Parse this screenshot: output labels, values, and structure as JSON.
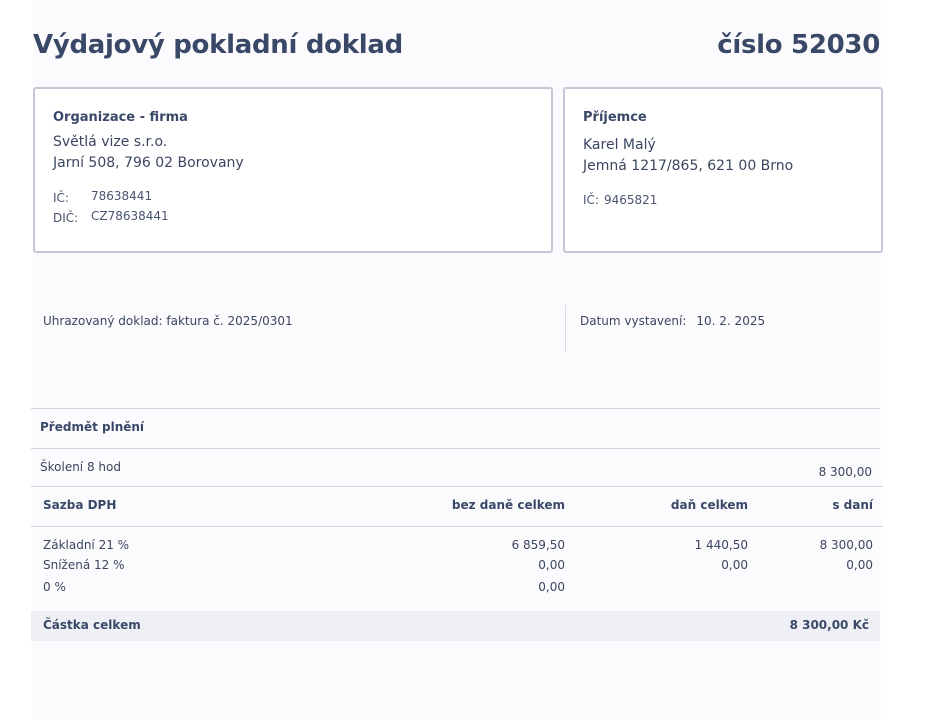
{
  "header": {
    "title": "Výdajový pokladní doklad",
    "number": "číslo 52030"
  },
  "organization": {
    "heading": "Organizace - firma",
    "name": "Světlá vize s.r.o.",
    "address": "Jarní 508, 796 02 Borovany",
    "ic_label": "IČ:",
    "ic": "78638441",
    "dic_label": "DIČ:",
    "dic": "CZ78638441"
  },
  "recipient": {
    "heading": "Příjemce",
    "name": "Karel Malý",
    "address": "Jemná 1217/865, 621 00 Brno",
    "ic_label": "IČ:",
    "ic": "9465821"
  },
  "meta": {
    "paid_document": "Uhrazovaný doklad: faktura č. 2025/0301",
    "issue_date_label": "Datum vystavení:",
    "issue_date": "10. 2. 2025"
  },
  "subject": {
    "heading": "Předmět plnění",
    "item": "Školení 8 hod",
    "amount": "8 300,00"
  },
  "vat_table": {
    "headers": [
      "Sazba DPH",
      "bez daně celkem",
      "daň celkem",
      "s daní"
    ],
    "rows": [
      [
        "Základní 21 %",
        "6 859,50",
        "1 440,50",
        "8 300,00"
      ],
      [
        "Snížená 12 %",
        "0,00",
        "0,00",
        "0,00"
      ],
      [
        "0 %",
        "0,00",
        "",
        ""
      ]
    ]
  },
  "total": {
    "label": "Částka celkem",
    "value": "8 300,00 Kč"
  }
}
